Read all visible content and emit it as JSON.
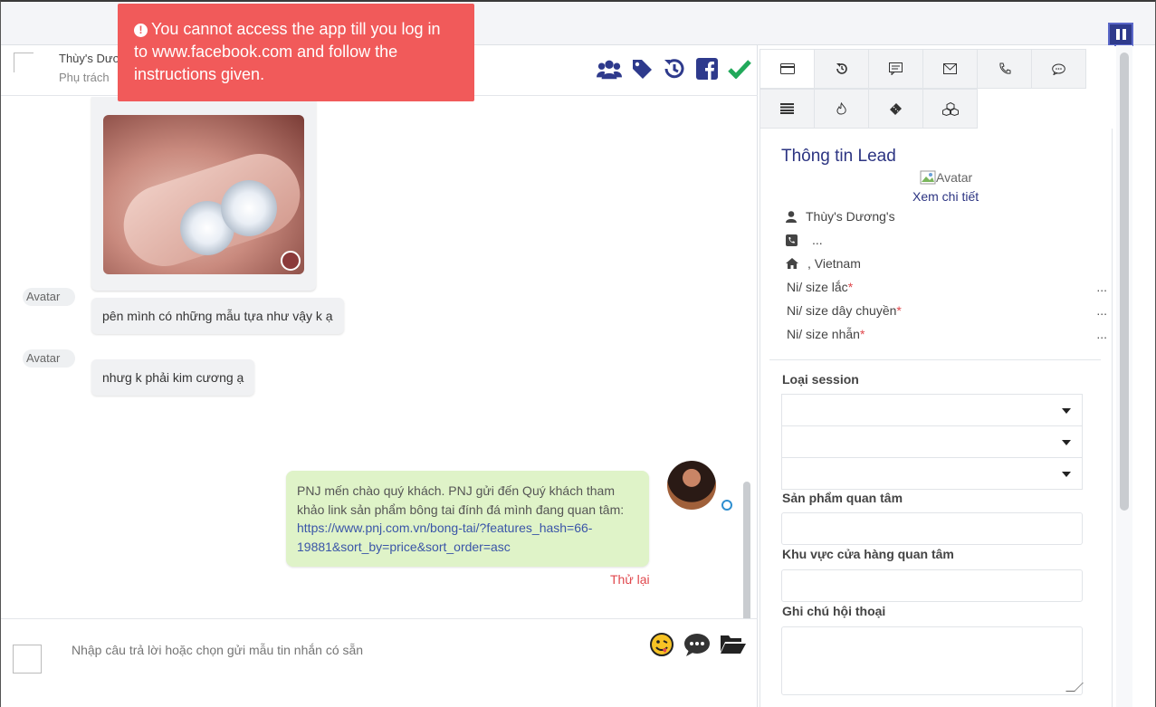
{
  "alert": {
    "message": "You cannot access the app till you log in to www.facebook.com and follow the instructions given."
  },
  "chat_header": {
    "name": "Thùy's Dươ",
    "subtitle": "Phụ trách"
  },
  "messages": {
    "incoming": [
      {
        "avatar_alt": "Avatar",
        "text": "pên mình có những mẫu tựa như vậy k ạ"
      },
      {
        "avatar_alt": "Avatar",
        "text": "nhưg k phải kim cương ạ"
      }
    ],
    "outgoing": {
      "text": "PNJ mến chào quý khách. PNJ gửi đến Quý khách tham khảo link sản phẩm bông tai đính đá mình đang quan tâm:",
      "link": "https://www.pnj.com.vn/bong-tai/?features_hash=66-19881&sort_by=price&sort_order=asc",
      "retry": "Thử lại"
    }
  },
  "composer": {
    "placeholder": "Nhập câu trả lời hoặc chọn gửi mẫu tin nhắn có sẵn"
  },
  "lead": {
    "title": "Thông tin Lead",
    "avatar_alt": "Avatar",
    "view_detail": "Xem chi tiết",
    "name": "Thùy's Dương's",
    "phone": "...",
    "address": ", Vietnam",
    "fields": [
      {
        "label": "Ni/ size lắc",
        "value": "..."
      },
      {
        "label": "Ni/ size dây chuyền",
        "value": "..."
      },
      {
        "label": "Ni/ size nhẫn",
        "value": "..."
      }
    ]
  },
  "form": {
    "session_label": "Loại session",
    "product_label": "Sản phẩm quan tâm",
    "store_label": "Khu vực cửa hàng quan tâm",
    "note_label": "Ghi chú hội thoại"
  },
  "colors": {
    "alert": "#f15a5a",
    "brand": "#2c3482",
    "outgoing_bubble": "#dff3c8",
    "icon_blue": "#2e3a8c",
    "check_green": "#21a95a",
    "retry_red": "#e0474c"
  }
}
